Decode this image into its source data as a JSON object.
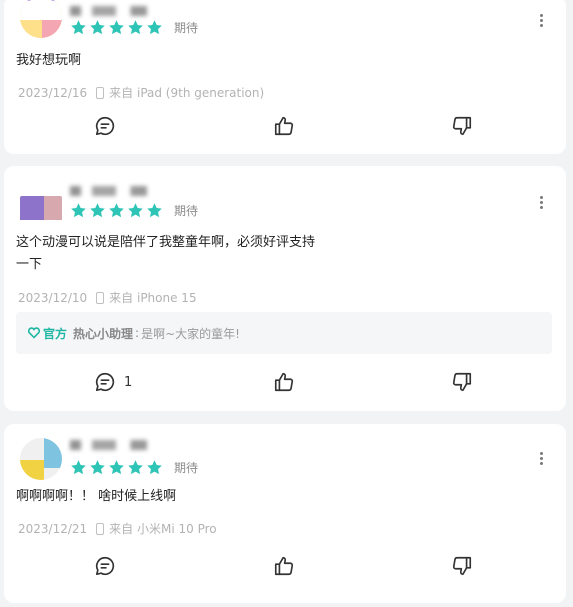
{
  "colors": {
    "star": "#2ec4b6",
    "official": "#1fb6a3",
    "meta": "#b3b3b3",
    "icon": "#333333"
  },
  "icons": {
    "rating": "star-icon",
    "device": "phone-icon",
    "more": "more-vertical-icon",
    "comment": "comment-icon",
    "like": "thumbs-up-icon",
    "dislike": "thumbs-down-icon",
    "official_badge": "heart-badge-icon"
  },
  "reviews": [
    {
      "stars": 5,
      "status": "期待",
      "text": "我好想玩啊",
      "date": "2023/12/16",
      "device": "来自 iPad (9th generation)",
      "comment_count": ""
    },
    {
      "stars": 5,
      "status": "期待",
      "text": "这个动漫可以说是陪伴了我整童年啊，必须好评支持一下",
      "date": "2023/12/10",
      "device": "来自 iPhone 15",
      "comment_count": "1",
      "reply": {
        "badge": "官方",
        "name": "热心小助理",
        "colon": ":",
        "text": "是啊~大家的童年!"
      }
    },
    {
      "stars": 5,
      "status": "期待",
      "text": "啊啊啊啊！！ 啥时候上线啊",
      "date": "2023/12/21",
      "device": "来自 小米Mi 10 Pro",
      "comment_count": ""
    }
  ]
}
